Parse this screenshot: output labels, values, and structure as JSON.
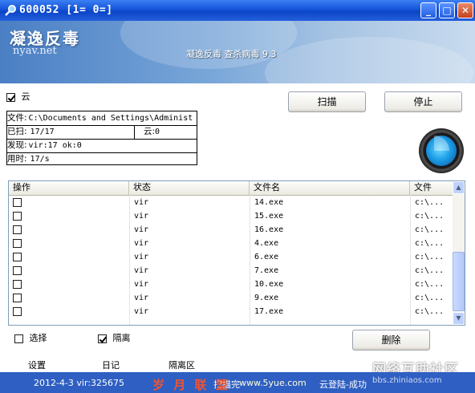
{
  "window": {
    "title": "600052 [1= 0=]",
    "minimize_label": "_",
    "maximize_label": "□",
    "close_label": "✕"
  },
  "banner": {
    "logo": "凝逸反毒",
    "site": "nyav.net",
    "subtitle": "凝逸反毒 查杀病毒 9.3"
  },
  "options": {
    "cloud_label": "云",
    "cloud_checked": true
  },
  "buttons": {
    "scan": "扫描",
    "stop": "停止",
    "delete": "删除"
  },
  "info": {
    "file_label": "文件:",
    "file_value": "C:\\Documents and Settings\\Administ",
    "scanned_label": "已扫:",
    "scanned_value": "17/17",
    "cloud_label": "云:",
    "cloud_value": "0",
    "found_label": "发现:",
    "found_value": "vir:17 ok:0",
    "time_label": "用时:",
    "time_value": "17/s"
  },
  "table": {
    "columns": [
      "操作",
      "状态",
      "文件名",
      "文件"
    ],
    "rows": [
      {
        "status": "vir",
        "filename": "14.exe",
        "path": "c:\\..."
      },
      {
        "status": "vir",
        "filename": "15.exe",
        "path": "c:\\..."
      },
      {
        "status": "vir",
        "filename": "16.exe",
        "path": "c:\\..."
      },
      {
        "status": "vir",
        "filename": "4.exe",
        "path": "c:\\..."
      },
      {
        "status": "vir",
        "filename": "6.exe",
        "path": "c:\\..."
      },
      {
        "status": "vir",
        "filename": "7.exe",
        "path": "c:\\..."
      },
      {
        "status": "vir",
        "filename": "10.exe",
        "path": "c:\\..."
      },
      {
        "status": "vir",
        "filename": "9.exe",
        "path": "c:\\..."
      },
      {
        "status": "vir",
        "filename": "17.exe",
        "path": "c:\\..."
      }
    ]
  },
  "bottom": {
    "select_label": "选择",
    "select_checked": false,
    "quarantine_label": "隔离",
    "quarantine_checked": true
  },
  "footer": {
    "settings": "设置",
    "log": "日记",
    "quarantine_zone": "隔离区"
  },
  "status": {
    "date_version": "2012-4-3 vir:325675",
    "scan_text": "扫描完",
    "login": "云登陆-成功"
  },
  "watermarks": {
    "left": "岁 月 联 盟",
    "left_url": "www.5yue.com",
    "right": "网络互助社区",
    "right_url": "bbs.zhiniaos.com"
  }
}
